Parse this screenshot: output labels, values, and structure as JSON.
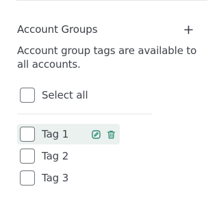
{
  "section": {
    "title": "Account Groups",
    "description": "Account group tags are available to all accounts.",
    "add_icon": "plus-icon"
  },
  "select_all": {
    "label": "Select all",
    "checked": false
  },
  "tags": [
    {
      "label": "Tag 1",
      "checked": false,
      "hovered": true
    },
    {
      "label": "Tag 2",
      "checked": false
    },
    {
      "label": "Tag 3",
      "checked": false
    }
  ],
  "tag_actions": {
    "edit_icon": "edit-icon",
    "delete_icon": "trash-icon"
  },
  "colors": {
    "accent": "#2e8b73",
    "hover_bg": "#eaf1ef",
    "divider": "#e4e6e8",
    "text": "#3f434a",
    "checkbox_border": "#6e7278"
  }
}
